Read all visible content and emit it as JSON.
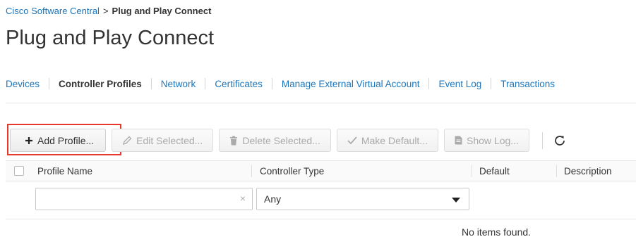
{
  "breadcrumb": {
    "root": "Cisco Software Central",
    "separator": ">",
    "current": "Plug and Play Connect"
  },
  "page_title": "Plug and Play Connect",
  "nav": {
    "tabs": [
      {
        "label": "Devices",
        "active": false
      },
      {
        "label": "Controller Profiles",
        "active": true
      },
      {
        "label": "Network",
        "active": false
      },
      {
        "label": "Certificates",
        "active": false
      },
      {
        "label": "Manage External Virtual Account",
        "active": false
      },
      {
        "label": "Event Log",
        "active": false
      },
      {
        "label": "Transactions",
        "active": false
      }
    ]
  },
  "toolbar": {
    "add_profile": "Add Profile...",
    "edit_selected": "Edit Selected...",
    "delete_selected": "Delete Selected...",
    "make_default": "Make Default...",
    "show_log": "Show Log..."
  },
  "table": {
    "columns": [
      "Profile Name",
      "Controller Type",
      "Default",
      "Description"
    ],
    "filters": {
      "profile_name_value": "",
      "clear_symbol": "×",
      "controller_type_selected": "Any"
    },
    "empty_message": "No items found."
  },
  "colors": {
    "link": "#1b75bb",
    "highlight": "#e8372c"
  }
}
